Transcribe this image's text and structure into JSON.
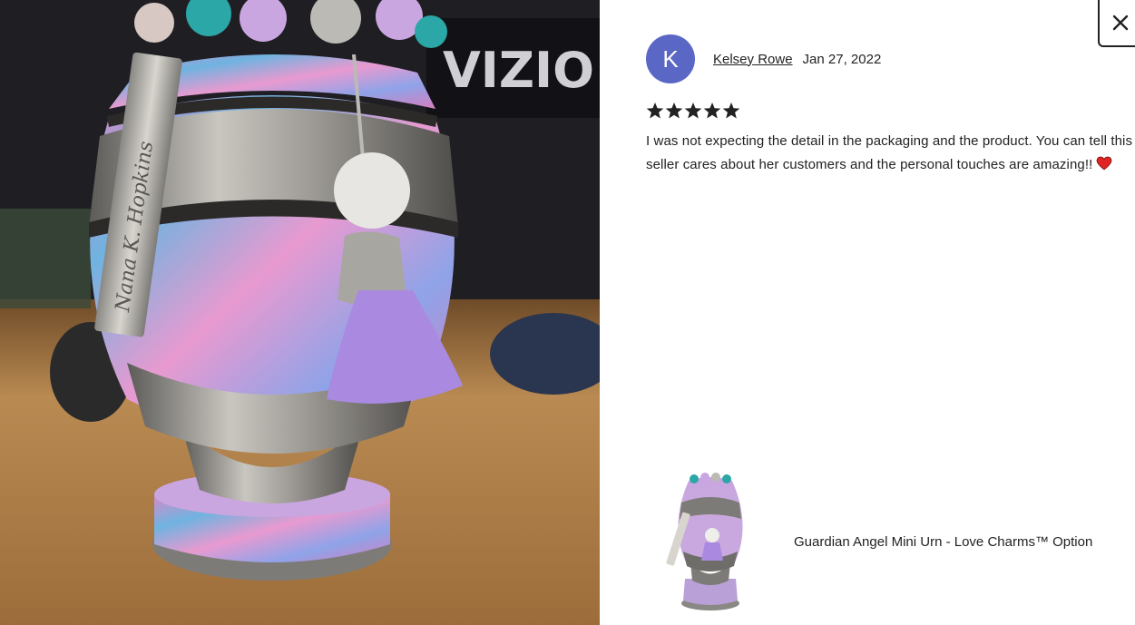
{
  "review": {
    "avatar_letter": "K",
    "reviewer_name": "Kelsey Rowe",
    "date": "Jan 27, 2022",
    "rating": 5,
    "text": "I was not expecting the detail in the packaging and the product. You can tell this seller cares about her customers and the personal touches are amazing!!"
  },
  "product": {
    "title": "Guardian Angel Mini Urn - Love Charms™ Option"
  },
  "photo": {
    "tag_engraving": "Nana K. Hopkins",
    "background_brand": "VIZIO"
  },
  "colors": {
    "avatar_bg": "#5a67c5",
    "heart": "#e02424"
  },
  "icons": {
    "close": "close-icon",
    "star": "star-icon",
    "heart": "heart-icon"
  }
}
